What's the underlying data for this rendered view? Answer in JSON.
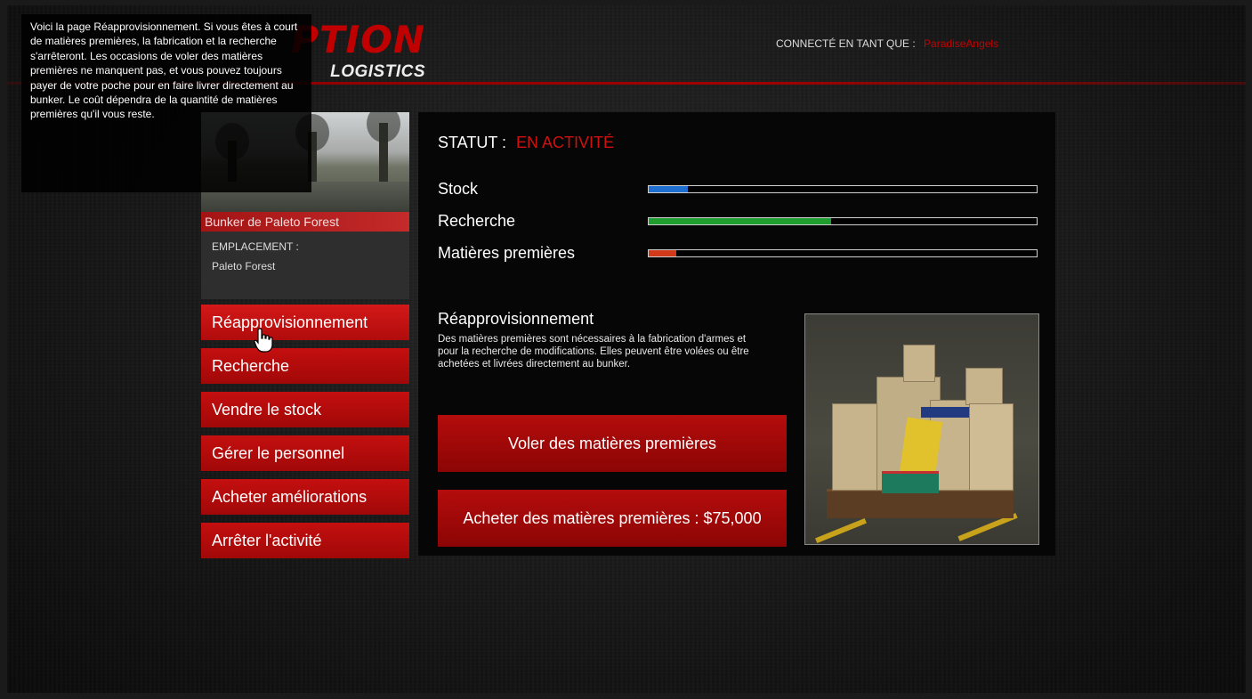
{
  "tooltip": {
    "text": "Voici la page Réapprovisionnement. Si vous êtes à court de matières premières, la fabrication et la recherche s'arrêteront. Les occasions de voler des matières premières ne manquent pas, et vous pouvez toujours payer de votre poche pour en faire livrer directement au bunker. Le coût dépendra de la quantité de matières premières qu'il vous reste."
  },
  "logo": {
    "main": "PTION",
    "sub": "LOGISTICS"
  },
  "header": {
    "login_label": "CONNECTÉ EN TANT QUE :",
    "username": "ParadiseAngels"
  },
  "bunker": {
    "name": "Bunker de Paleto Forest",
    "location_label": "EMPLACEMENT :",
    "location_value": "Paleto Forest"
  },
  "menu": {
    "items": [
      {
        "label": "Réapprovisionnement"
      },
      {
        "label": "Recherche"
      },
      {
        "label": "Vendre le stock"
      },
      {
        "label": "Gérer le personnel"
      },
      {
        "label": "Acheter améliorations"
      },
      {
        "label": "Arrêter l'activité"
      }
    ]
  },
  "status": {
    "label": "STATUT :",
    "value": "EN ACTIVITÉ"
  },
  "stats": [
    {
      "label": "Stock",
      "fraction": 0.1,
      "color": "#1e6fd0"
    },
    {
      "label": "Recherche",
      "fraction": 0.47,
      "color": "#1f9d2f"
    },
    {
      "label": "Matières premières",
      "fraction": 0.07,
      "color": "#d03a1a"
    }
  ],
  "resupply": {
    "title": "Réapprovisionnement",
    "description": "Des matières premières sont nécessaires à la fabrication d'armes et pour la recherche de modifications. Elles peuvent être volées ou être achetées et livrées directement au bunker.",
    "steal_label": "Voler des matières premières",
    "buy_label": "Acheter des matières premières : $75,000"
  },
  "colors": {
    "accent": "#c40f0f",
    "status": "#d01010"
  }
}
